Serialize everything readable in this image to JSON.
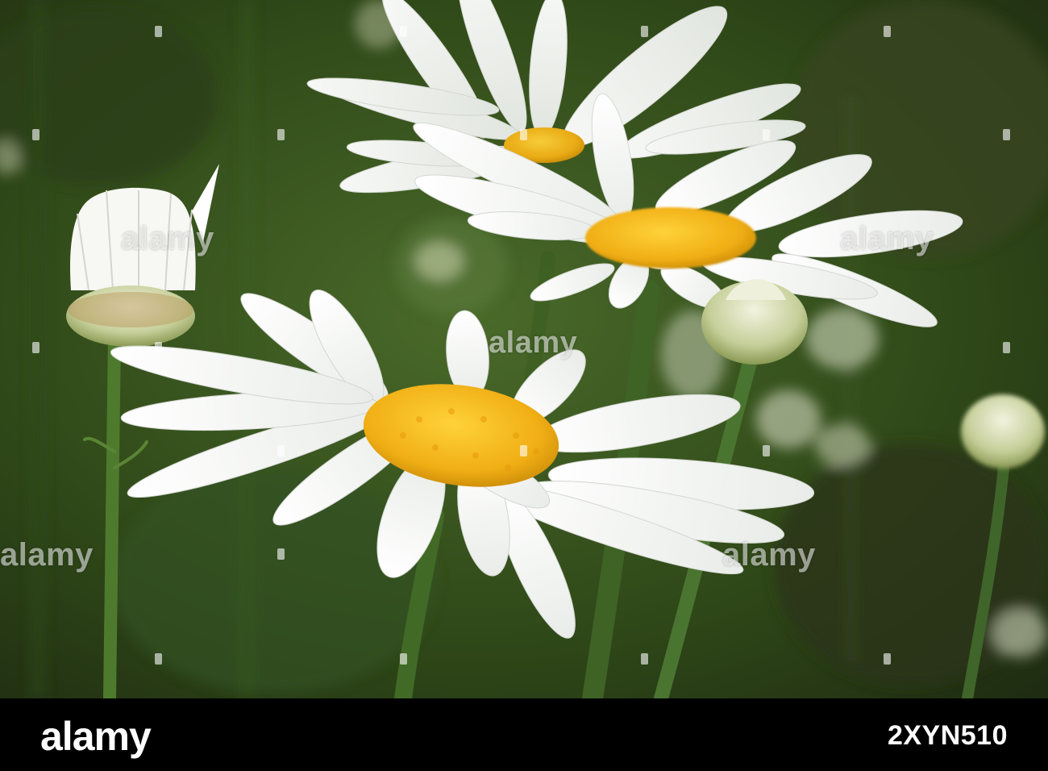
{
  "image": {
    "description_tags": [
      "daisy",
      "flower"
    ],
    "colors": {
      "background_dark": "#1f2a12",
      "background_mid": "#3c5a22",
      "petal": "#ffffff",
      "petal_shadow": "#dfe2df",
      "disc": "#f2b51a",
      "stem": "#4f7a2c"
    }
  },
  "watermarks": {
    "text": "alamy",
    "repeat_count": 5
  },
  "footer": {
    "logo": "alamy",
    "image_id": "2XYN510",
    "background": "#000000",
    "text_color": "#ffffff"
  }
}
